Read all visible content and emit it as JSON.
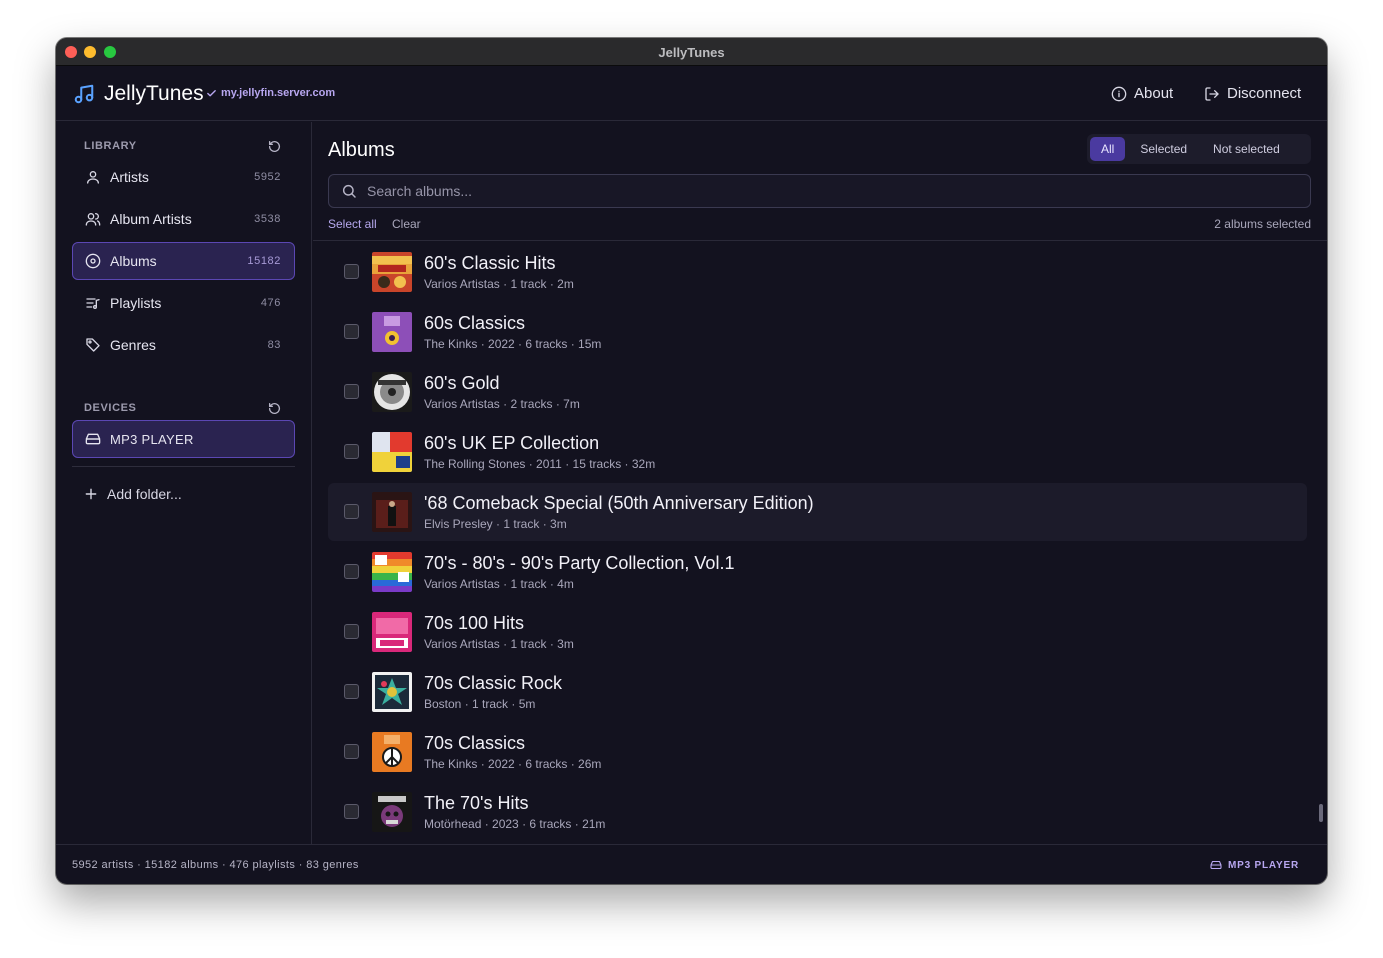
{
  "window": {
    "title": "JellyTunes"
  },
  "header": {
    "app_name": "JellyTunes",
    "server": "my.jellyfin.server.com",
    "about_label": "About",
    "disconnect_label": "Disconnect"
  },
  "sidebar": {
    "library_label": "LIBRARY",
    "items": [
      {
        "label": "Artists",
        "count": "5952",
        "icon": "person-icon"
      },
      {
        "label": "Album Artists",
        "count": "3538",
        "icon": "people-icon"
      },
      {
        "label": "Albums",
        "count": "15182",
        "icon": "disc-icon",
        "active": true
      },
      {
        "label": "Playlists",
        "count": "476",
        "icon": "playlist-icon"
      },
      {
        "label": "Genres",
        "count": "83",
        "icon": "tag-icon"
      }
    ],
    "devices_label": "DEVICES",
    "device": {
      "label": "MP3 PLAYER",
      "icon": "drive-icon"
    },
    "add_folder_label": "Add folder..."
  },
  "main": {
    "title": "Albums",
    "filters": [
      "All",
      "Selected",
      "Not selected"
    ],
    "active_filter": "All",
    "search_placeholder": "Search albums...",
    "select_all_label": "Select all",
    "clear_label": "Clear",
    "selected_count": "2 albums selected",
    "albums": [
      {
        "title": "60's Classic Hits",
        "meta": "Varios Artistas · 1 track · 2m",
        "checked": false
      },
      {
        "title": "60s Classics",
        "meta": "The Kinks · 2022 · 6 tracks · 15m",
        "checked": false
      },
      {
        "title": "60's Gold",
        "meta": "Varios Artistas · 2 tracks · 7m",
        "checked": false
      },
      {
        "title": "60's UK EP Collection",
        "meta": "The Rolling Stones · 2011 · 15 tracks · 32m",
        "checked": false
      },
      {
        "title": "'68 Comeback Special (50th Anniversary Edition)",
        "meta": "Elvis Presley · 1 track · 3m",
        "checked": false
      },
      {
        "title": "70's - 80's - 90's Party Collection, Vol.1",
        "meta": "Varios Artistas · 1 track · 4m",
        "checked": false
      },
      {
        "title": "70s 100 Hits",
        "meta": "Varios Artistas · 1 track · 3m",
        "checked": false
      },
      {
        "title": "70s Classic Rock",
        "meta": "Boston · 1 track · 5m",
        "checked": false
      },
      {
        "title": "70s Classics",
        "meta": "The Kinks · 2022 · 6 tracks · 26m",
        "checked": false
      },
      {
        "title": "The 70's Hits",
        "meta": "Motörhead · 2023 · 6 tracks · 21m",
        "checked": false
      }
    ]
  },
  "footer": {
    "stats": "5952 artists · 15182 albums · 476 playlists · 83 genres",
    "device": "MP3 PLAYER"
  },
  "colors": {
    "background": "#13121f",
    "accent": "#4a3aa0",
    "accent_text": "#b8a7f0"
  }
}
